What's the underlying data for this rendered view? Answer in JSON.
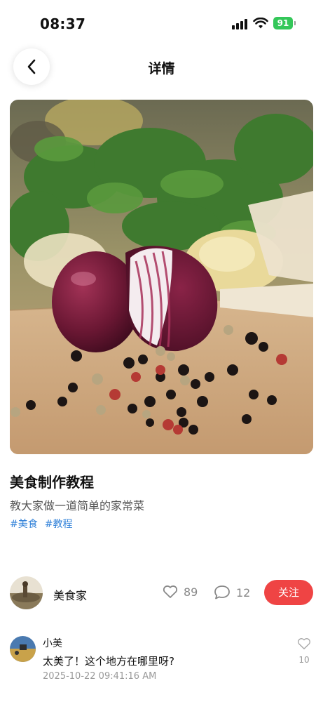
{
  "status_bar": {
    "time": "08:37",
    "battery": "91",
    "battery_color": "#34c759"
  },
  "header": {
    "title": "详情",
    "back_icon": "chevron-left-icon"
  },
  "hero_image": {
    "description": "red onion, parsley and peppercorns on a cutting board"
  },
  "post": {
    "title": "美食制作教程",
    "description": "教大家做一道简单的家常菜",
    "tags": [
      "#美食",
      "#教程"
    ]
  },
  "author": {
    "name": "美食家",
    "likes": "89",
    "comments": "12",
    "follow_label": "关注"
  },
  "comments": [
    {
      "user": "小美",
      "text": "太美了！这个地方在哪里呀?",
      "time": "2025-10-22 09:41:16 AM",
      "likes": "10"
    }
  ],
  "colors": {
    "accent": "#ef4444",
    "tag": "#2f80d8"
  }
}
